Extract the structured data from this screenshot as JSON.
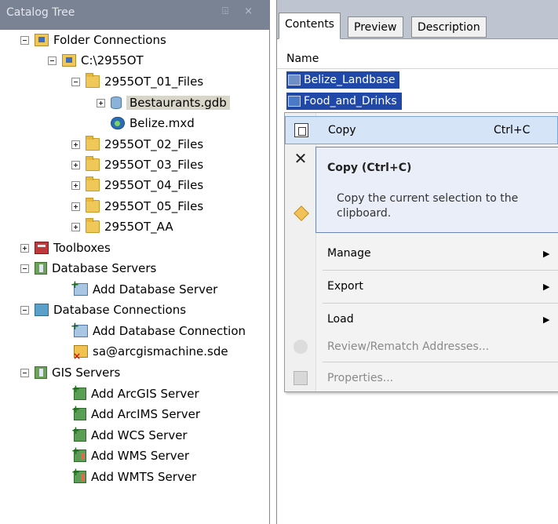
{
  "catalog": {
    "title": "Catalog Tree",
    "title_icons": "⌹ ×",
    "items": [
      {
        "label": "Folder Connections"
      },
      {
        "label": "C:\\2955OT"
      },
      {
        "label": "2955OT_01_Files"
      },
      {
        "label": "Bestaurants.gdb"
      },
      {
        "label": "Belize.mxd"
      },
      {
        "label": "2955OT_02_Files"
      },
      {
        "label": "2955OT_03_Files"
      },
      {
        "label": "2955OT_04_Files"
      },
      {
        "label": "2955OT_05_Files"
      },
      {
        "label": "2955OT_AA"
      },
      {
        "label": "Toolboxes"
      },
      {
        "label": "Database Servers"
      },
      {
        "label": "Add Database Server"
      },
      {
        "label": "Database Connections"
      },
      {
        "label": "Add Database Connection"
      },
      {
        "label": "sa@arcgismachine.sde"
      },
      {
        "label": "GIS Servers"
      },
      {
        "label": "Add ArcGIS Server"
      },
      {
        "label": "Add ArcIMS Server"
      },
      {
        "label": "Add WCS Server"
      },
      {
        "label": "Add WMS Server"
      },
      {
        "label": "Add WMTS Server"
      }
    ]
  },
  "contents": {
    "tabs": [
      {
        "label": "Contents"
      },
      {
        "label": "Preview"
      },
      {
        "label": "Description"
      }
    ],
    "column_header": "Name",
    "items": [
      {
        "label": "Belize_Landbase"
      },
      {
        "label": "Food_and_Drinks"
      }
    ]
  },
  "context_menu": {
    "copy": {
      "label": "Copy",
      "shortcut": "Ctrl+C"
    },
    "manage": "Manage",
    "export": "Export",
    "load": "Load",
    "review": "Review/Rematch Addresses...",
    "properties": "Properties...",
    "arrow": "▶"
  },
  "tooltip": {
    "title": "Copy (Ctrl+C)",
    "body": "Copy the current selection to the clipboard."
  },
  "colors": {
    "title_bar": "#7a8393",
    "tab_strip": "#bfc5d0",
    "selection": "#2048a8",
    "menu_highlight": "#d5e4f7"
  }
}
